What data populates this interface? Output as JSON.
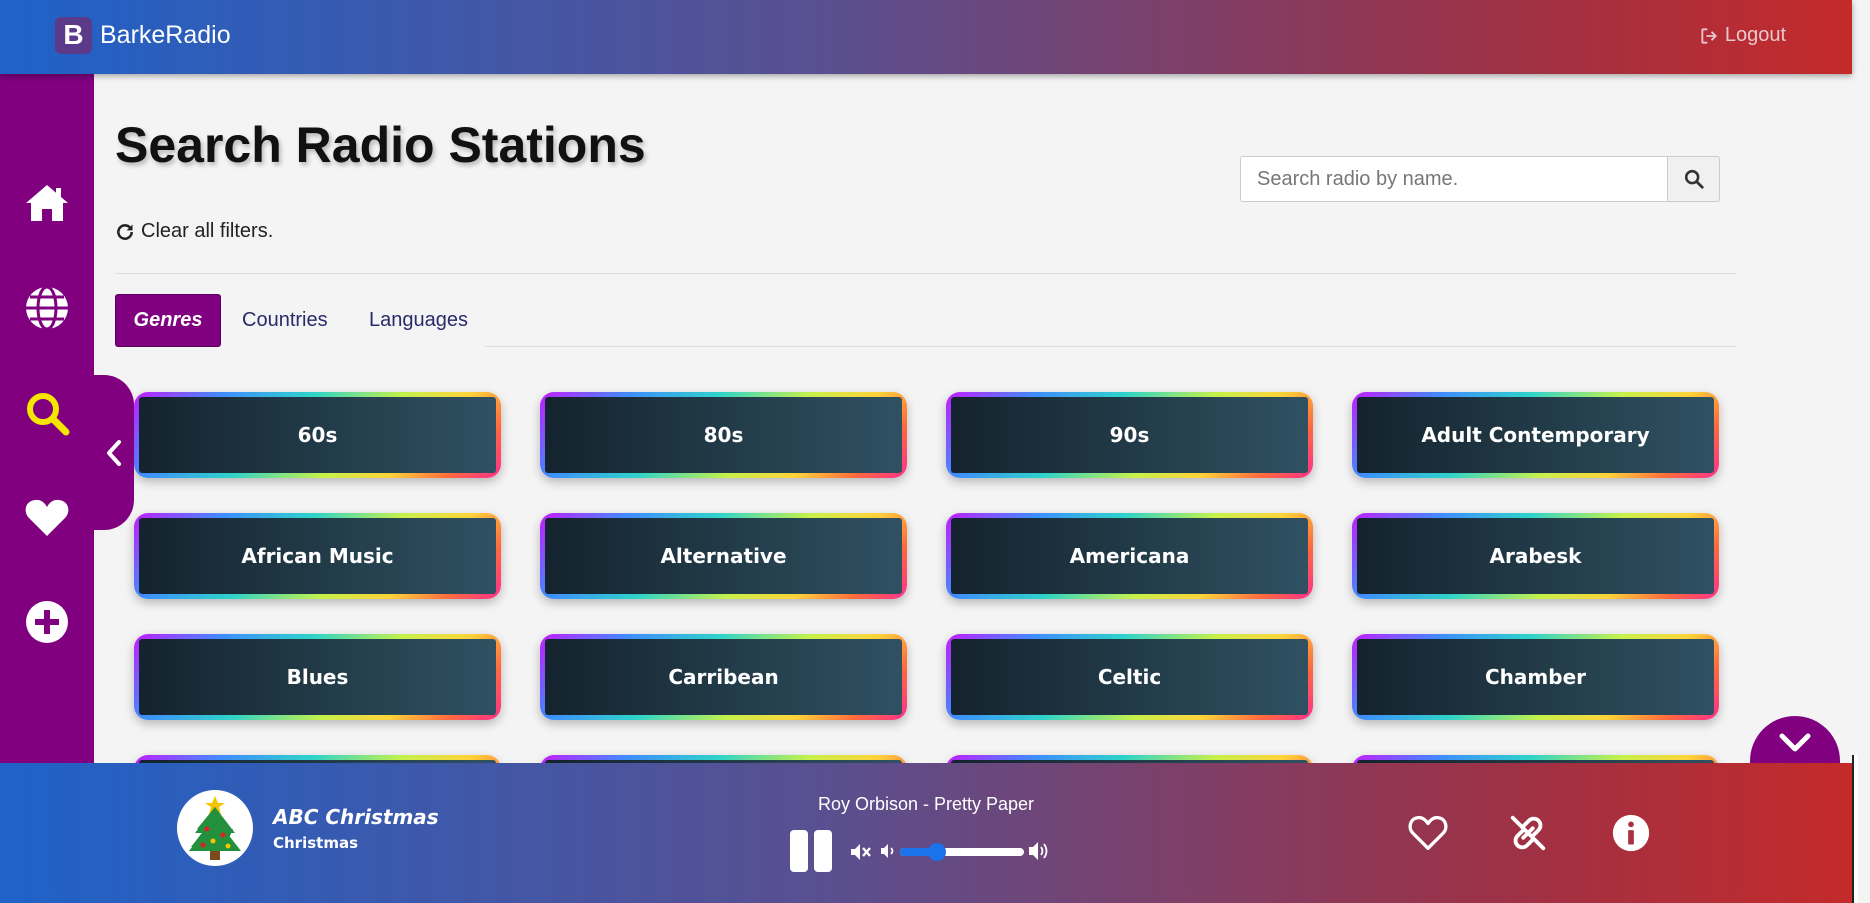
{
  "app": {
    "brand_letter": "B",
    "brand_name": "BarkeRadio",
    "logout_label": "Logout"
  },
  "sidebar": {
    "items": [
      {
        "name": "home",
        "icon": "home-icon",
        "color": "#ffffff"
      },
      {
        "name": "globe",
        "icon": "globe-icon",
        "color": "#ffffff"
      },
      {
        "name": "search",
        "icon": "search-icon",
        "color": "#f5e600"
      },
      {
        "name": "favorites",
        "icon": "heart-icon",
        "color": "#ffffff"
      },
      {
        "name": "add",
        "icon": "plus-circle-icon",
        "color": "#ffffff"
      }
    ]
  },
  "page": {
    "title": "Search Radio Stations",
    "clear_filters_label": "Clear all filters.",
    "search_placeholder": "Search radio by name."
  },
  "tabs": [
    {
      "label": "Genres",
      "active": true
    },
    {
      "label": "Countries",
      "active": false
    },
    {
      "label": "Languages",
      "active": false
    }
  ],
  "genres": [
    "60s",
    "80s",
    "90s",
    "Adult Contemporary",
    "African Music",
    "Alternative",
    "Americana",
    "Arabesk",
    "Blues",
    "Carribean",
    "Celtic",
    "Chamber"
  ],
  "player": {
    "station_name": "ABC Christmas",
    "station_genre": "Christmas",
    "now_playing": "Roy Orbison - Pretty Paper",
    "volume": 0.3
  },
  "colors": {
    "accent": "#800080",
    "volume": "#1a73e8"
  }
}
